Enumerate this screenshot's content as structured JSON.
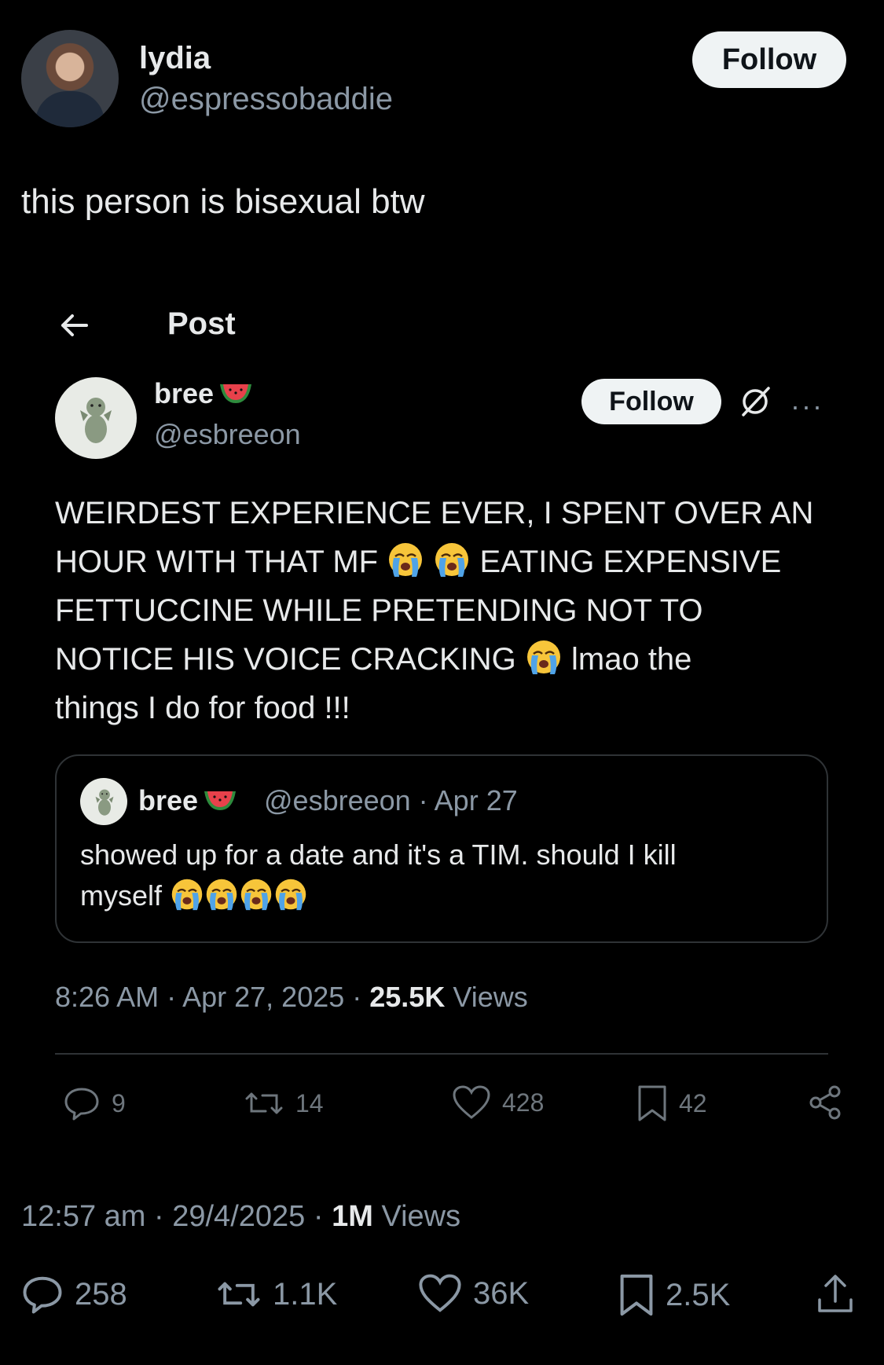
{
  "outer_post": {
    "author": {
      "name": "lydia",
      "handle": "@espressobaddie"
    },
    "follow_label": "Follow",
    "text": "this person is bisexual btw",
    "meta": {
      "time": "12:57 am",
      "date": "29/4/2025",
      "views_count": "1M",
      "views_label": "Views"
    },
    "actions": {
      "replies": "258",
      "reposts": "1.1K",
      "likes": "36K",
      "bookmarks": "2.5K"
    }
  },
  "embedded_screenshot": {
    "header": {
      "title": "Post"
    },
    "author": {
      "name": "bree",
      "handle": "@esbreeon"
    },
    "follow_label": "Follow",
    "tweet_text": {
      "line1": "WEIRDEST EXPERIENCE EVER, I SPENT OVER AN",
      "line2a": "HOUR WITH THAT MF",
      "line2b": "EATING EXPENSIVE",
      "line3": "FETTUCCINE WHILE PRETENDING NOT TO",
      "line4a": "NOTICE HIS VOICE CRACKING",
      "line4b": "lmao the",
      "line5": "things I do for food !!!"
    },
    "quoted": {
      "name": "bree",
      "meta": "@esbreeon · Apr 27",
      "text_line1": "showed up for a date and it's a TIM. should I kill",
      "text_line2": "myself"
    },
    "meta": {
      "time": "8:26 AM",
      "date": "Apr 27, 2025",
      "views_count": "25.5K",
      "views_label": "Views"
    },
    "actions": {
      "replies": "9",
      "reposts": "14",
      "likes": "428",
      "bookmarks": "42"
    }
  },
  "icons": {
    "back": "back-arrow-icon",
    "reply": "reply-icon",
    "repost": "repost-icon",
    "like": "heart-icon",
    "bookmark": "bookmark-icon",
    "share": "share-icon",
    "grok": "grok-icon",
    "more": "more-icon",
    "emoji_cry": "loudly-crying-emoji",
    "emoji_watermelon": "watermelon-emoji"
  },
  "colors": {
    "background": "#000000",
    "text": "#e7e9ea",
    "secondary": "#8b98a5",
    "button_bg": "#eff3f4",
    "divider": "#2f3336"
  }
}
